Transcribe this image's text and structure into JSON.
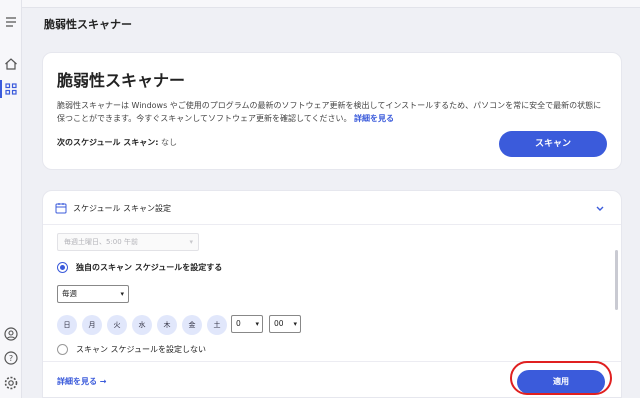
{
  "header": {
    "title": "脆弱性スキャナー"
  },
  "rail": {
    "icons": [
      "menu-icon",
      "home-icon",
      "apps-icon",
      "account-icon",
      "help-icon",
      "settings-icon"
    ]
  },
  "scanner": {
    "title": "脆弱性スキャナー",
    "description": "脆弱性スキャナーは Windows やご使用のプログラムの最新のソフトウェア更新を検出してインストールするため、パソコンを常に安全で最新の状態に保つことができます。今すぐスキャンしてソフトウェア更新を確認してください。",
    "more_link": "詳細を見る",
    "next_scan_label": "次のスケジュール スキャン:",
    "next_scan_value": "なし",
    "scan_button": "スキャン"
  },
  "schedule": {
    "section_title": "スケジュール スキャン設定",
    "disabled_select_value": "毎週土曜日、5:00 午前",
    "option_custom": "独自のスキャン スケジュールを設定する",
    "frequency_value": "毎週",
    "days": [
      "日",
      "月",
      "火",
      "水",
      "木",
      "金",
      "土"
    ],
    "hour_value": "0",
    "minute_value": "00",
    "option_none": "スキャン スケジュールを設定しない",
    "more_link": "詳細を見る →",
    "apply_button": "適用"
  },
  "colors": {
    "accent": "#3b5bdb",
    "highlight": "#e02020"
  }
}
